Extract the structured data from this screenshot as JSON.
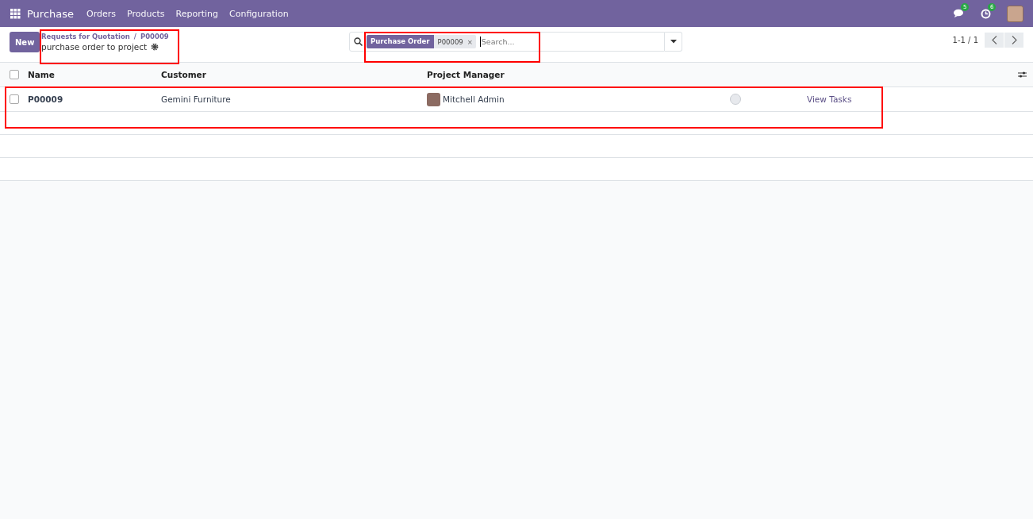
{
  "navbar": {
    "app": "Purchase",
    "menus": [
      "Orders",
      "Products",
      "Reporting",
      "Configuration"
    ],
    "messages_badge": "5",
    "activities_badge": "6"
  },
  "control_panel": {
    "new_button": "New",
    "breadcrumb": "Requests for Quotation",
    "breadcrumb_separator": "/",
    "breadcrumb_current": "P00009",
    "action_title": "purchase order to project",
    "search": {
      "facet_label": "Purchase Order",
      "facet_value": "P00009",
      "facet_remove": "×",
      "placeholder": "Search..."
    },
    "pager": "1-1 / 1"
  },
  "table": {
    "select_all_checked": false,
    "columns": [
      "Name",
      "Customer",
      "Project Manager"
    ],
    "rows": [
      {
        "name": "P00009",
        "customer": "Gemini Furniture",
        "manager": "Mitchell Admin",
        "link": "View Tasks",
        "checked": false
      }
    ]
  }
}
